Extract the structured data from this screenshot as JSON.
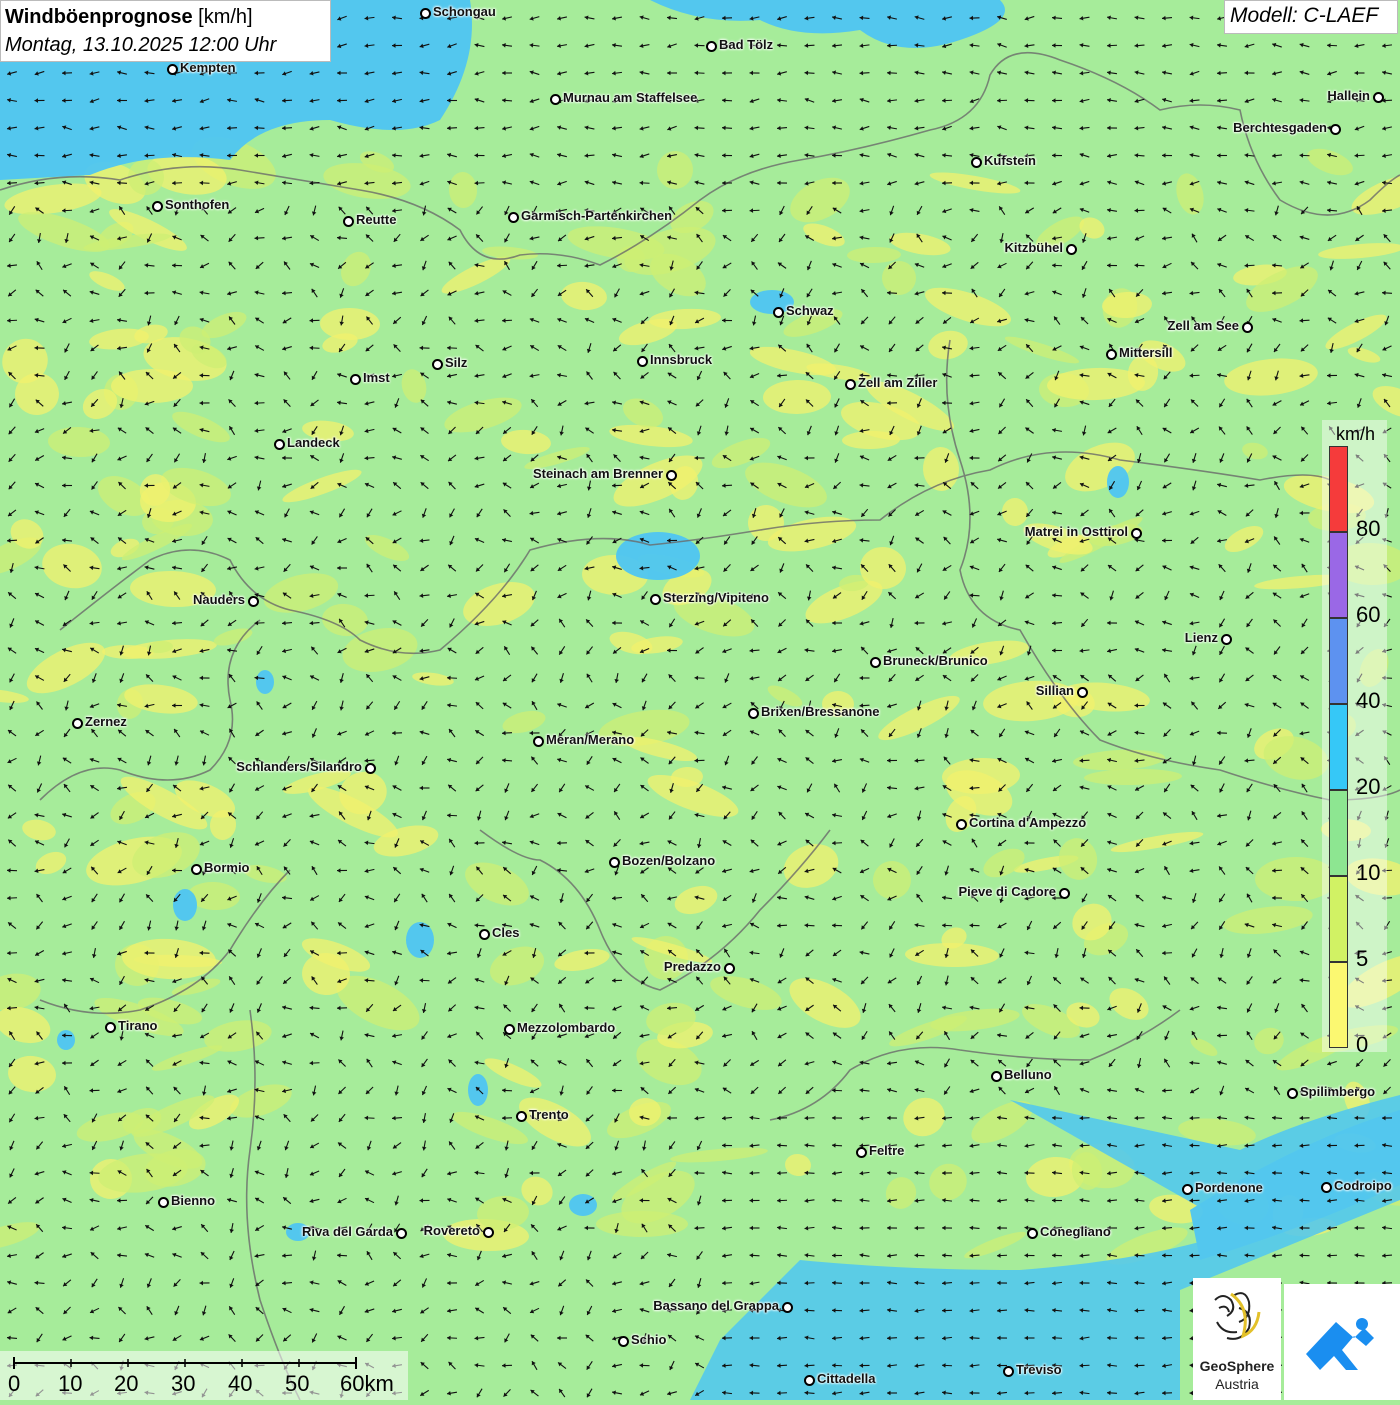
{
  "header": {
    "title_bold": "Windböenprognose",
    "title_unit": "[km/h]",
    "subtitle": "Montag, 13.10.2025 12:00 Uhr",
    "model": "Modell: C-LAEF"
  },
  "legend": {
    "unit": "km/h",
    "ticks": [
      "80",
      "60",
      "40",
      "20",
      "10",
      "5",
      "0"
    ],
    "bands": [
      {
        "label": "80+",
        "color": "#f53b3b"
      },
      {
        "label": "60-80",
        "color": "#9a68e6"
      },
      {
        "label": "40-60",
        "color": "#5d92f0"
      },
      {
        "label": "20-40",
        "color": "#36c8f7"
      },
      {
        "label": "10-20",
        "color": "#8de691"
      },
      {
        "label": "5-10",
        "color": "#d1f264"
      },
      {
        "label": "0-5",
        "color": "#fbf871"
      }
    ]
  },
  "scale": {
    "labels": [
      "0",
      "10",
      "20",
      "30",
      "40",
      "50",
      "60km"
    ]
  },
  "logos": {
    "geosphere_line1": "GeoSphere",
    "geosphere_line2": "Austria"
  },
  "cities": [
    {
      "name": "Schongau"
    },
    {
      "name": "Bad Tölz"
    },
    {
      "name": "Kempten"
    },
    {
      "name": "Murnau am Staffelsee"
    },
    {
      "name": "Hallein"
    },
    {
      "name": "Berchtesgaden"
    },
    {
      "name": "Kufstein"
    },
    {
      "name": "Sonthofen"
    },
    {
      "name": "Reutte"
    },
    {
      "name": "Garmisch-Partenkirchen"
    },
    {
      "name": "Kitzbühel"
    },
    {
      "name": "Schwaz"
    },
    {
      "name": "Zell am See"
    },
    {
      "name": "Mittersill"
    },
    {
      "name": "Innsbruck"
    },
    {
      "name": "Imst"
    },
    {
      "name": "Silz"
    },
    {
      "name": "Zell am Ziller"
    },
    {
      "name": "Landeck"
    },
    {
      "name": "Steinach am Brenner"
    },
    {
      "name": "Matrei in Osttirol"
    },
    {
      "name": "Nauders"
    },
    {
      "name": "Sterzing/Vipiteno"
    },
    {
      "name": "Lienz"
    },
    {
      "name": "Bruneck/Brunico"
    },
    {
      "name": "Sillian"
    },
    {
      "name": "Zernez"
    },
    {
      "name": "Brixen/Bressanone"
    },
    {
      "name": "Meran/Merano"
    },
    {
      "name": "Schlanders/Silandro"
    },
    {
      "name": "Cortina d'Ampezzo"
    },
    {
      "name": "Bozen/Bolzano"
    },
    {
      "name": "Bormio"
    },
    {
      "name": "Pieve di Cadore"
    },
    {
      "name": "Cles"
    },
    {
      "name": "Predazzo"
    },
    {
      "name": "Tirano"
    },
    {
      "name": "Mezzolombardo"
    },
    {
      "name": "Belluno"
    },
    {
      "name": "Spilimbergo"
    },
    {
      "name": "Trento"
    },
    {
      "name": "Feltre"
    },
    {
      "name": "Bienno"
    },
    {
      "name": "Pordenone"
    },
    {
      "name": "Codroipo"
    },
    {
      "name": "Riva del Garda"
    },
    {
      "name": "Rovereto"
    },
    {
      "name": "Conegliano"
    },
    {
      "name": "Bassano del Grappa"
    },
    {
      "name": "Schio"
    },
    {
      "name": "Treviso"
    },
    {
      "name": "Cittadella"
    }
  ]
}
